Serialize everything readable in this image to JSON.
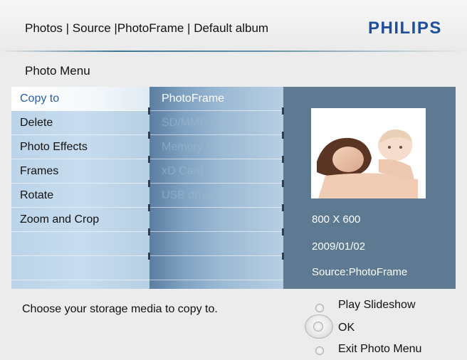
{
  "header": {
    "breadcrumb": "Photos | Source |PhotoFrame | Default album",
    "logo": "PHILIPS"
  },
  "page_title": "Photo Menu",
  "menu": {
    "items": [
      {
        "label": "Copy to",
        "selected": true
      },
      {
        "label": "Delete"
      },
      {
        "label": "Photo Effects"
      },
      {
        "label": "Frames"
      },
      {
        "label": "Rotate"
      },
      {
        "label": "Zoom and Crop"
      }
    ]
  },
  "submenu": {
    "items": [
      {
        "label": "PhotoFrame",
        "enabled": true
      },
      {
        "label": "SD/MMC Card",
        "enabled": false
      },
      {
        "label": "Memory Stick",
        "enabled": false
      },
      {
        "label": "xD Card",
        "enabled": false
      },
      {
        "label": "USB drive",
        "enabled": false
      }
    ]
  },
  "preview": {
    "resolution": "800 X 600",
    "date": "2009/01/02",
    "source": "Source:PhotoFrame"
  },
  "footer": {
    "hint": "Choose your storage media to copy to.",
    "controls": {
      "play": "Play Slideshow",
      "ok": "OK",
      "exit": "Exit Photo Menu"
    }
  },
  "colors": {
    "brand": "#1d4f9a",
    "selected_text": "#2a5fa8",
    "panel_bg": "#5d7a92"
  }
}
